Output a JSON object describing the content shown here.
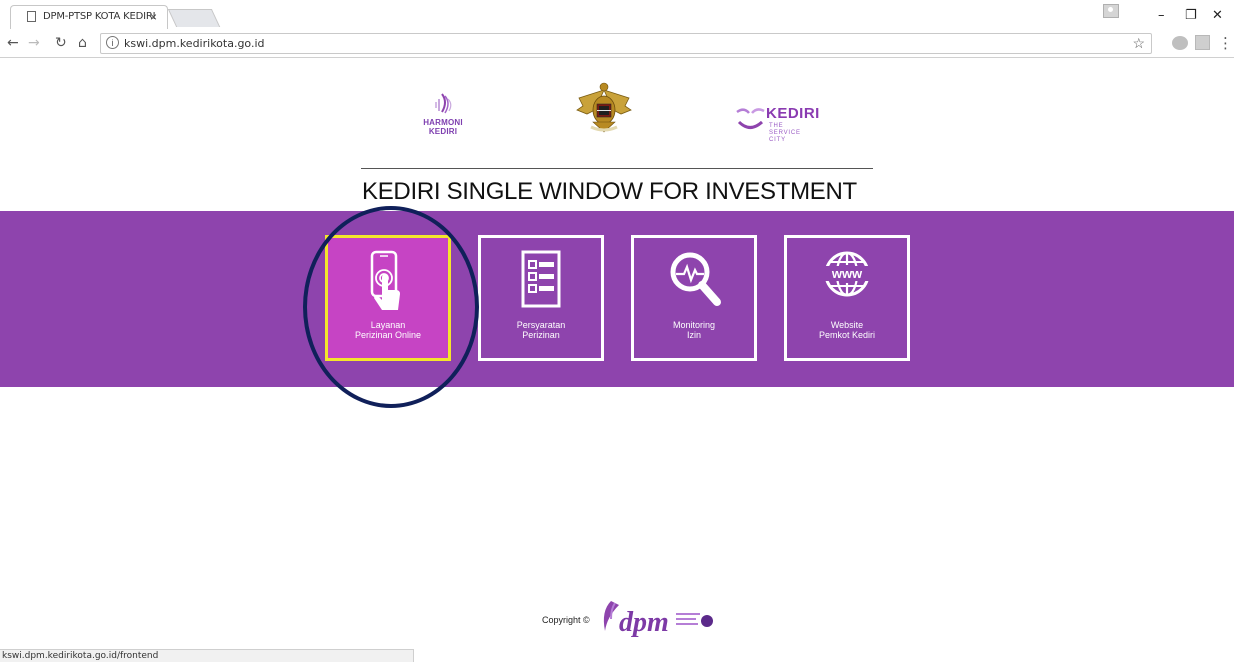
{
  "browser": {
    "tab_title": "DPM-PTSP KOTA KEDIRI",
    "tab_close": "×",
    "url": "kswi.dpm.kedirikota.go.id",
    "status_url": "kswi.dpm.kedirikota.go.id/frontend",
    "icons": [
      "page-icon",
      "back-icon",
      "forward-icon",
      "reload-icon",
      "home-icon",
      "info-icon",
      "star-icon",
      "menu-icon"
    ]
  },
  "header": {
    "logo_left_line1": "HARMONI",
    "logo_left_line2": "KEDIRI",
    "logo_right_word": "KEDIRI",
    "logo_right_sub1": "THE",
    "logo_right_sub2": "SERVICE",
    "logo_right_sub3": "CITY"
  },
  "page": {
    "title": "KEDIRI SINGLE WINDOW FOR INVESTMENT"
  },
  "tiles": [
    {
      "line1": "Layanan",
      "line2": "Perizinan Online",
      "icon": "phone-touch-icon",
      "active": true
    },
    {
      "line1": "Persyaratan",
      "line2": "Perizinan",
      "icon": "checklist-icon",
      "active": false
    },
    {
      "line1": "Monitoring",
      "line2": "Izin",
      "icon": "magnifier-pulse-icon",
      "active": false
    },
    {
      "line1": "Website",
      "line2": "Pemkot Kediri",
      "icon": "globe-www-icon",
      "active": false
    }
  ],
  "footer": {
    "copyright": "Copyright ©"
  },
  "colors": {
    "band": "#8e44ad",
    "active_tile": "#c644c4",
    "active_border": "#f4e62b",
    "annotation": "#10205a"
  }
}
